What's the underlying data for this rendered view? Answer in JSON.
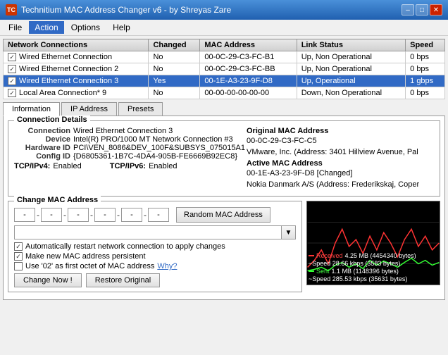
{
  "titleBar": {
    "icon": "TC",
    "title": "Technitium MAC Address Changer v6 - by Shreyas Zare",
    "controls": [
      "–",
      "□",
      "✕"
    ]
  },
  "menuBar": {
    "items": [
      "File",
      "Action",
      "Options",
      "Help"
    ]
  },
  "networkTable": {
    "columns": [
      "Network Connections",
      "Changed",
      "MAC Address",
      "Link Status",
      "Speed"
    ],
    "rows": [
      {
        "name": "Wired Ethernet Connection",
        "changed": "No",
        "mac": "00-0C-29-C3-FC-B1",
        "status": "Up, Non Operational",
        "speed": "0 bps",
        "checked": true,
        "selected": false
      },
      {
        "name": "Wired Ethernet Connection 2",
        "changed": "No",
        "mac": "00-0C-29-C3-FC-BB",
        "status": "Up, Non Operational",
        "speed": "0 bps",
        "checked": true,
        "selected": false
      },
      {
        "name": "Wired Ethernet Connection 3",
        "changed": "Yes",
        "mac": "00-1E-A3-23-9F-D8",
        "status": "Up, Operational",
        "speed": "1 gbps",
        "checked": true,
        "selected": true
      },
      {
        "name": "Local Area Connection* 9",
        "changed": "No",
        "mac": "00-00-00-00-00-00",
        "status": "Down, Non Operational",
        "speed": "0 bps",
        "checked": true,
        "selected": false
      }
    ]
  },
  "tabs": {
    "items": [
      "Information",
      "IP Address",
      "Presets"
    ],
    "active": 0
  },
  "connectionDetails": {
    "groupTitle": "Connection Details",
    "connection": {
      "label": "Connection",
      "value": "Wired Ethernet Connection 3"
    },
    "device": {
      "label": "Device",
      "value": "Intel(R) PRO/1000 MT Network Connection #3"
    },
    "hardwareId": {
      "label": "Hardware ID",
      "value": "PCI\\VEN_8086&DEV_100F&SUBSYS_075015A1"
    },
    "configId": {
      "label": "Config ID",
      "value": "{D6805361-1B7C-4DA4-905B-FE6669B92EC8}"
    },
    "tcpipv4": {
      "label": "TCP/IPv4:",
      "value": "Enabled"
    },
    "tcpipv6": {
      "label": "TCP/IPv6:",
      "value": "Enabled"
    },
    "originalMac": {
      "title": "Original MAC Address",
      "line1": "00-0C-29-C3-FC-C5",
      "line2": "VMware, Inc. (Address: 3401 Hillview Avenue, Pal"
    },
    "activeMac": {
      "title": "Active MAC Address",
      "line1": "00-1E-A3-23-9F-D8 [Changed]",
      "line2": "Nokia Danmark A/S  (Address: Frederikskaj, Coper"
    }
  },
  "changeMac": {
    "groupTitle": "Change MAC Address",
    "fields": [
      "-",
      "-",
      "-",
      "-",
      "-",
      "-"
    ],
    "randomBtn": "Random MAC Address",
    "checkboxes": [
      {
        "label": "Automatically restart network connection to apply changes",
        "checked": true
      },
      {
        "label": "Make new MAC address persistent",
        "checked": true
      },
      {
        "label": "Use '02' as first octet of MAC address",
        "checked": false
      }
    ],
    "whyText": "Why?",
    "buttons": {
      "changeNow": "Change Now !",
      "restore": "Restore Original"
    }
  },
  "graph": {
    "legend": {
      "received": {
        "label": "Received",
        "value": "4.25 MB (4454340 bytes)",
        "speed": "~Speed  28.66 kbps (3583 bytes)"
      },
      "sent": {
        "label": "Sent",
        "value": "1.1 MB (1148396 bytes)",
        "speed": "~Speed  285.53 kbps (35631 bytes)"
      }
    }
  }
}
